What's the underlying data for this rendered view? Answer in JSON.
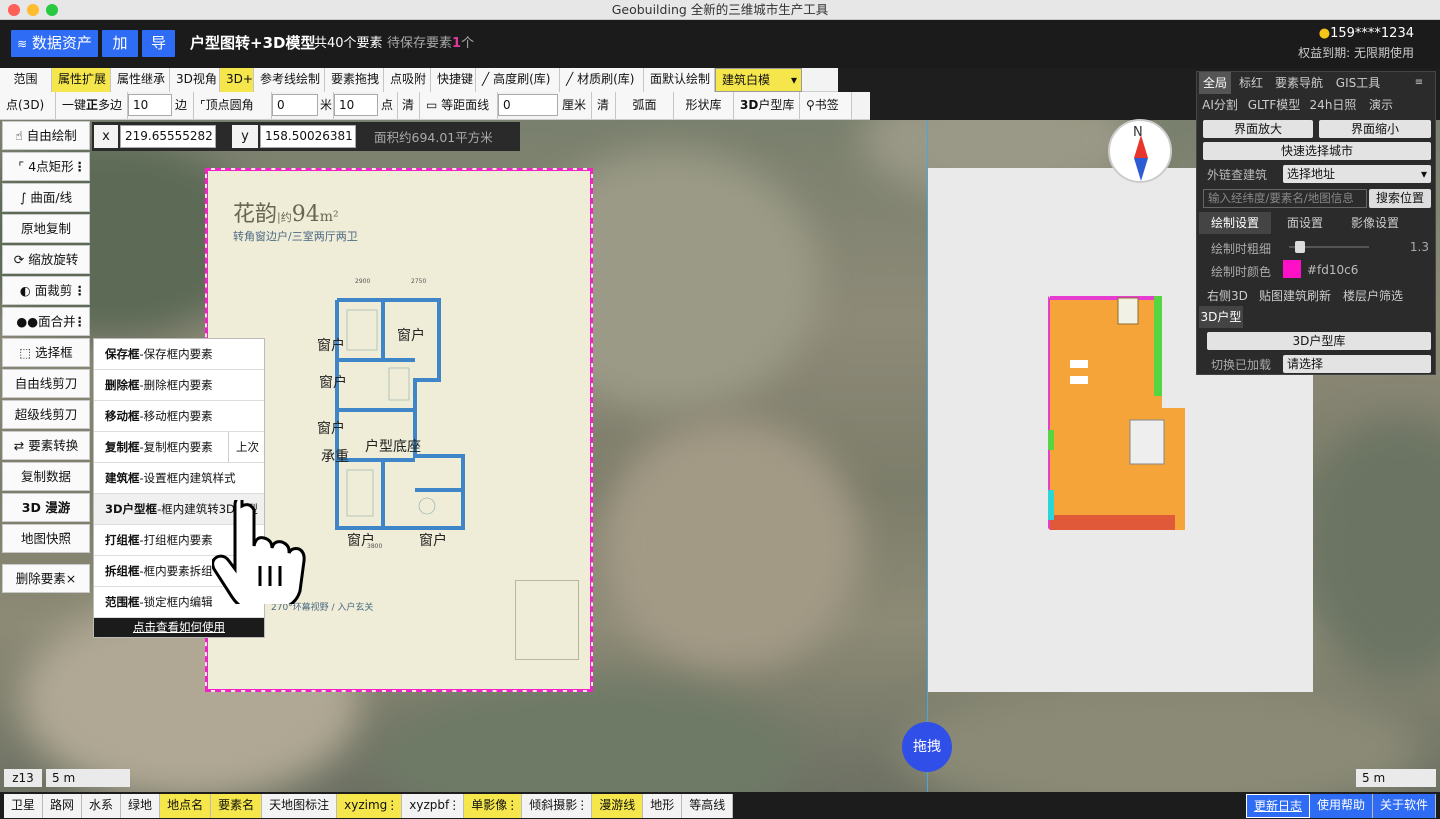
{
  "window": {
    "title": "Geobuilding 全新的三维城市生产工具"
  },
  "header": {
    "data_assets": "数据资产",
    "add": "加",
    "export": "导",
    "title": "户型图转+3D模型",
    "count": "共40个要素",
    "pending_prefix": "待保存要素",
    "pending_num": "1",
    "pending_suffix": "个",
    "user": "159****1234",
    "rights": "权益到期: 无限期使用"
  },
  "toolbar1": [
    "范围",
    "属性扩展",
    "属性继承",
    "3D视角",
    "3D+",
    "参考线绘制",
    "要素拖拽",
    "点吸附",
    "快捷键",
    "高度刷(库)",
    "材质刷(库)",
    "面默认绘制",
    "建筑白模"
  ],
  "toolbar2": {
    "point3d": "点(3D)",
    "one_key": "一键",
    "zheng": "正",
    "polygon": "多边",
    "sides": "10",
    "bian": "边",
    "vertex_round": "顶点圆角",
    "round_val": "0",
    "mi": "米",
    "pts": "10",
    "dian": "点",
    "clear": "清",
    "equidist": "等距面线",
    "equi_val": "0",
    "cm": "厘米",
    "clear2": "清",
    "arc": "弧面",
    "shape_lib": "形状库",
    "huxing_lib_b": "3D",
    "huxing_lib": "户型库",
    "bookmark": "书签"
  },
  "coords": {
    "x_label": "x",
    "x_val": "219.65555282",
    "y_label": "y",
    "y_val": "158.50026381",
    "area": "面积约694.01平方米"
  },
  "left_tools": [
    "自由绘制",
    "4点矩形",
    "曲面/线",
    "原地复制",
    "缩放旋转",
    "面裁剪",
    "面合并",
    "选择框",
    "自由线剪刀",
    "超级线剪刀",
    "要素转换",
    "复制数据",
    "3D 漫游",
    "地图快照",
    "删除要素×"
  ],
  "context_menu": {
    "items": [
      {
        "b": "保存框",
        "t": "-保存框内要素"
      },
      {
        "b": "删除框",
        "t": "-删除框内要素"
      },
      {
        "b": "移动框",
        "t": "-移动框内要素"
      },
      {
        "b": "复制框",
        "t": "-复制框内要素"
      },
      {
        "b": "建筑框",
        "t": "-设置框内建筑样式"
      },
      {
        "b": "3D户型框",
        "t": "-框内建筑转3D户型"
      },
      {
        "b": "打组框",
        "t": "-打组框内要素"
      },
      {
        "b": "拆组框",
        "t": "-框内要素拆组"
      },
      {
        "b": "范围框",
        "t": "-锁定框内编辑"
      }
    ],
    "prev": "上次",
    "help_link": "点击查看如何使用"
  },
  "plan": {
    "name": "花韵",
    "area_prefix": "|约",
    "area": "94",
    "unit": "m²",
    "subtitle": "转角窗边户/三室两厅两卫",
    "win1": "窗户",
    "win2": "窗户",
    "win3": "窗户",
    "win4": "窗户",
    "win5": "窗户",
    "win6": "窗户",
    "wall": "承重",
    "base": "户型底座",
    "dim1": "2900",
    "dim2": "2750",
    "dim3": "3800",
    "bottom_text": "270°环幕视野 / 入户玄关"
  },
  "right_panel": {
    "tabs1": [
      "全局",
      "标红",
      "要素导航",
      "GIS工具"
    ],
    "tabs2": [
      "AI分割",
      "GLTF模型",
      "24h日照",
      "演示"
    ],
    "zoom_in": "界面放大",
    "zoom_out": "界面缩小",
    "quick_city": "快速选择城市",
    "ext_building": "外链查建筑",
    "select_addr": "选择地址",
    "search_placeholder": "输入经纬度/要素名/地图信息",
    "search_btn": "搜索位置",
    "subtabs": [
      "绘制设置",
      "面设置",
      "影像设置"
    ],
    "thickness_label": "绘制时粗细",
    "thickness_val": "1.3",
    "color_label": "绘制时颜色",
    "color_val": "#fd10c6",
    "links": [
      "右侧3D",
      "贴图建筑刷新",
      "楼层户筛选"
    ],
    "huxing3d": "3D户型",
    "huxing_lib": "3D户型库",
    "switch_loaded": "切换已加载",
    "select": "请选择"
  },
  "map": {
    "zoom": "z13",
    "scale_left": "5 m",
    "scale_right": "5 m",
    "drag": "拖拽",
    "compass": "N"
  },
  "bottom": [
    "卫星",
    "路网",
    "水系",
    "绿地",
    "地点名",
    "要素名",
    "天地图标注",
    "xyzimg",
    "xyzpbf",
    "单影像",
    "倾斜摄影",
    "漫游线",
    "地形",
    "等高线"
  ],
  "bottom_right": [
    "更新日志",
    "使用帮助",
    "关于软件"
  ],
  "colors": {
    "accent": "#2f6cf5",
    "yellow": "#f5e64b",
    "magenta": "#f022c8",
    "orange": "#f5a43a"
  }
}
